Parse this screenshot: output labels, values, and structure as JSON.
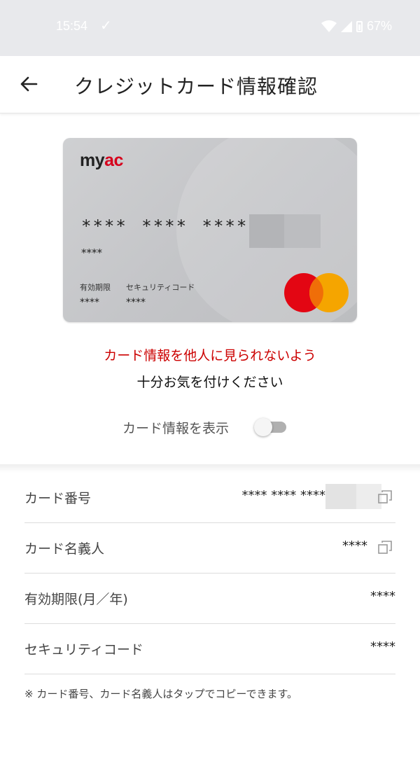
{
  "status_bar": {
    "time": "15:54",
    "battery_percent": "67%"
  },
  "app_bar": {
    "title": "クレジットカード情報確認"
  },
  "card": {
    "logo_part1": "my",
    "logo_part2": "ac",
    "number_masked": "**** **** ****",
    "holder_masked": "****",
    "expiry_label": "有効期限",
    "security_label": "セキュリティコード",
    "expiry_value": "****",
    "security_value": "****"
  },
  "warning": {
    "line1": "カード情報を他人に見られないよう",
    "line2": "十分お気を付けください"
  },
  "toggle": {
    "label": "カード情報を表示",
    "state": "off"
  },
  "details": {
    "rows": [
      {
        "label": "カード番号",
        "value": "**** **** ****"
      },
      {
        "label": "カード名義人",
        "value": "****"
      },
      {
        "label": "有効期限(月／年)",
        "value": "****"
      },
      {
        "label": "セキュリティコード",
        "value": "****"
      }
    ]
  },
  "footnote": "※ カード番号、カード名義人はタップでコピーできます。",
  "colors": {
    "warning_red": "#cc0000",
    "logo_red": "#d6001c",
    "mastercard_red": "#e30613",
    "mastercard_yellow": "#f5a500"
  }
}
